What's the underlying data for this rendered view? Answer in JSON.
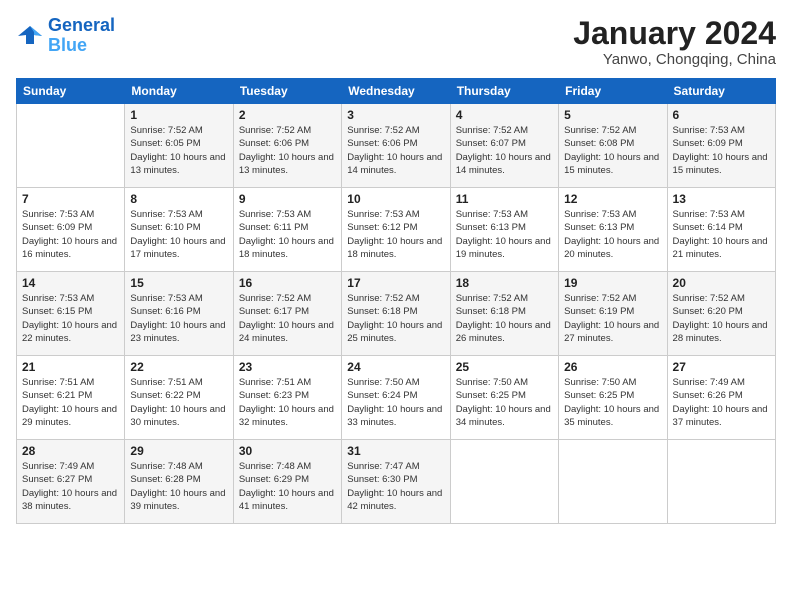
{
  "header": {
    "logo_line1": "General",
    "logo_line2": "Blue",
    "month": "January 2024",
    "location": "Yanwo, Chongqing, China"
  },
  "days_of_week": [
    "Sunday",
    "Monday",
    "Tuesday",
    "Wednesday",
    "Thursday",
    "Friday",
    "Saturday"
  ],
  "weeks": [
    [
      {
        "day": "",
        "sunrise": "",
        "sunset": "",
        "daylight": ""
      },
      {
        "day": "1",
        "sunrise": "Sunrise: 7:52 AM",
        "sunset": "Sunset: 6:05 PM",
        "daylight": "Daylight: 10 hours and 13 minutes."
      },
      {
        "day": "2",
        "sunrise": "Sunrise: 7:52 AM",
        "sunset": "Sunset: 6:06 PM",
        "daylight": "Daylight: 10 hours and 13 minutes."
      },
      {
        "day": "3",
        "sunrise": "Sunrise: 7:52 AM",
        "sunset": "Sunset: 6:06 PM",
        "daylight": "Daylight: 10 hours and 14 minutes."
      },
      {
        "day": "4",
        "sunrise": "Sunrise: 7:52 AM",
        "sunset": "Sunset: 6:07 PM",
        "daylight": "Daylight: 10 hours and 14 minutes."
      },
      {
        "day": "5",
        "sunrise": "Sunrise: 7:52 AM",
        "sunset": "Sunset: 6:08 PM",
        "daylight": "Daylight: 10 hours and 15 minutes."
      },
      {
        "day": "6",
        "sunrise": "Sunrise: 7:53 AM",
        "sunset": "Sunset: 6:09 PM",
        "daylight": "Daylight: 10 hours and 15 minutes."
      }
    ],
    [
      {
        "day": "7",
        "sunrise": "Sunrise: 7:53 AM",
        "sunset": "Sunset: 6:09 PM",
        "daylight": "Daylight: 10 hours and 16 minutes."
      },
      {
        "day": "8",
        "sunrise": "Sunrise: 7:53 AM",
        "sunset": "Sunset: 6:10 PM",
        "daylight": "Daylight: 10 hours and 17 minutes."
      },
      {
        "day": "9",
        "sunrise": "Sunrise: 7:53 AM",
        "sunset": "Sunset: 6:11 PM",
        "daylight": "Daylight: 10 hours and 18 minutes."
      },
      {
        "day": "10",
        "sunrise": "Sunrise: 7:53 AM",
        "sunset": "Sunset: 6:12 PM",
        "daylight": "Daylight: 10 hours and 18 minutes."
      },
      {
        "day": "11",
        "sunrise": "Sunrise: 7:53 AM",
        "sunset": "Sunset: 6:13 PM",
        "daylight": "Daylight: 10 hours and 19 minutes."
      },
      {
        "day": "12",
        "sunrise": "Sunrise: 7:53 AM",
        "sunset": "Sunset: 6:13 PM",
        "daylight": "Daylight: 10 hours and 20 minutes."
      },
      {
        "day": "13",
        "sunrise": "Sunrise: 7:53 AM",
        "sunset": "Sunset: 6:14 PM",
        "daylight": "Daylight: 10 hours and 21 minutes."
      }
    ],
    [
      {
        "day": "14",
        "sunrise": "Sunrise: 7:53 AM",
        "sunset": "Sunset: 6:15 PM",
        "daylight": "Daylight: 10 hours and 22 minutes."
      },
      {
        "day": "15",
        "sunrise": "Sunrise: 7:53 AM",
        "sunset": "Sunset: 6:16 PM",
        "daylight": "Daylight: 10 hours and 23 minutes."
      },
      {
        "day": "16",
        "sunrise": "Sunrise: 7:52 AM",
        "sunset": "Sunset: 6:17 PM",
        "daylight": "Daylight: 10 hours and 24 minutes."
      },
      {
        "day": "17",
        "sunrise": "Sunrise: 7:52 AM",
        "sunset": "Sunset: 6:18 PM",
        "daylight": "Daylight: 10 hours and 25 minutes."
      },
      {
        "day": "18",
        "sunrise": "Sunrise: 7:52 AM",
        "sunset": "Sunset: 6:18 PM",
        "daylight": "Daylight: 10 hours and 26 minutes."
      },
      {
        "day": "19",
        "sunrise": "Sunrise: 7:52 AM",
        "sunset": "Sunset: 6:19 PM",
        "daylight": "Daylight: 10 hours and 27 minutes."
      },
      {
        "day": "20",
        "sunrise": "Sunrise: 7:52 AM",
        "sunset": "Sunset: 6:20 PM",
        "daylight": "Daylight: 10 hours and 28 minutes."
      }
    ],
    [
      {
        "day": "21",
        "sunrise": "Sunrise: 7:51 AM",
        "sunset": "Sunset: 6:21 PM",
        "daylight": "Daylight: 10 hours and 29 minutes."
      },
      {
        "day": "22",
        "sunrise": "Sunrise: 7:51 AM",
        "sunset": "Sunset: 6:22 PM",
        "daylight": "Daylight: 10 hours and 30 minutes."
      },
      {
        "day": "23",
        "sunrise": "Sunrise: 7:51 AM",
        "sunset": "Sunset: 6:23 PM",
        "daylight": "Daylight: 10 hours and 32 minutes."
      },
      {
        "day": "24",
        "sunrise": "Sunrise: 7:50 AM",
        "sunset": "Sunset: 6:24 PM",
        "daylight": "Daylight: 10 hours and 33 minutes."
      },
      {
        "day": "25",
        "sunrise": "Sunrise: 7:50 AM",
        "sunset": "Sunset: 6:25 PM",
        "daylight": "Daylight: 10 hours and 34 minutes."
      },
      {
        "day": "26",
        "sunrise": "Sunrise: 7:50 AM",
        "sunset": "Sunset: 6:25 PM",
        "daylight": "Daylight: 10 hours and 35 minutes."
      },
      {
        "day": "27",
        "sunrise": "Sunrise: 7:49 AM",
        "sunset": "Sunset: 6:26 PM",
        "daylight": "Daylight: 10 hours and 37 minutes."
      }
    ],
    [
      {
        "day": "28",
        "sunrise": "Sunrise: 7:49 AM",
        "sunset": "Sunset: 6:27 PM",
        "daylight": "Daylight: 10 hours and 38 minutes."
      },
      {
        "day": "29",
        "sunrise": "Sunrise: 7:48 AM",
        "sunset": "Sunset: 6:28 PM",
        "daylight": "Daylight: 10 hours and 39 minutes."
      },
      {
        "day": "30",
        "sunrise": "Sunrise: 7:48 AM",
        "sunset": "Sunset: 6:29 PM",
        "daylight": "Daylight: 10 hours and 41 minutes."
      },
      {
        "day": "31",
        "sunrise": "Sunrise: 7:47 AM",
        "sunset": "Sunset: 6:30 PM",
        "daylight": "Daylight: 10 hours and 42 minutes."
      },
      {
        "day": "",
        "sunrise": "",
        "sunset": "",
        "daylight": ""
      },
      {
        "day": "",
        "sunrise": "",
        "sunset": "",
        "daylight": ""
      },
      {
        "day": "",
        "sunrise": "",
        "sunset": "",
        "daylight": ""
      }
    ]
  ]
}
